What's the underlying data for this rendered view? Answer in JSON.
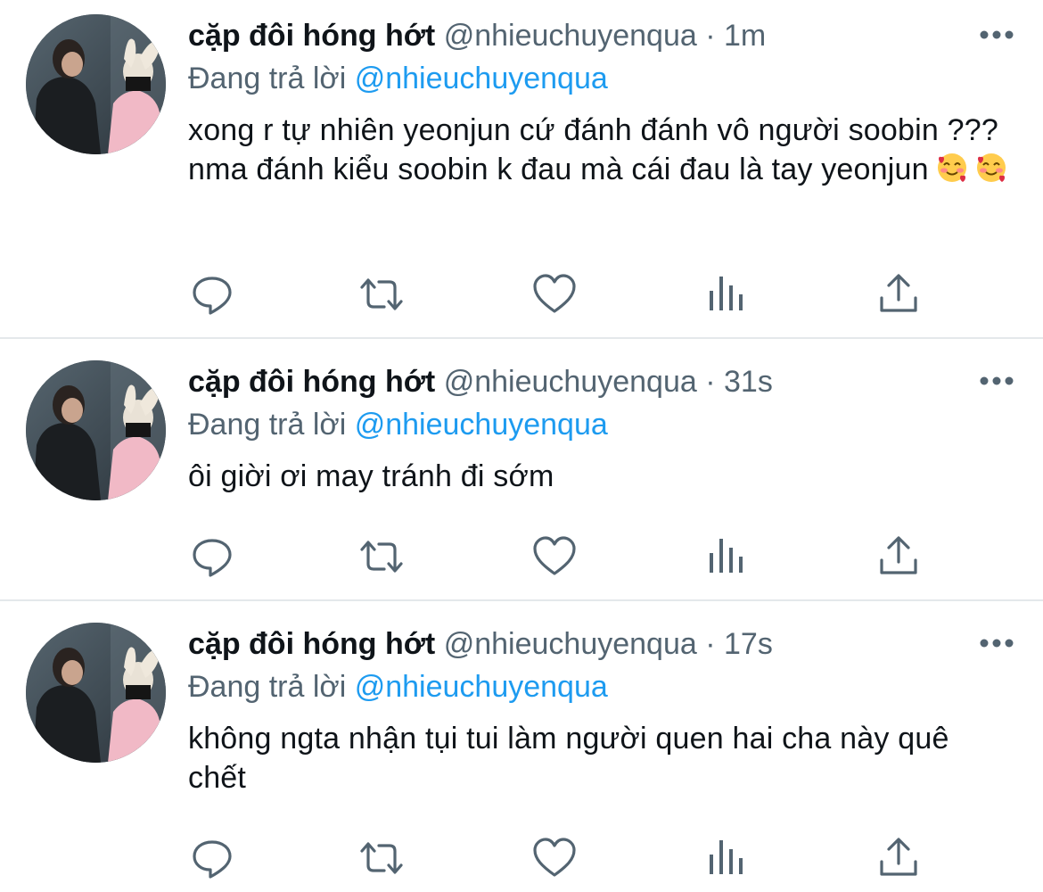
{
  "colors": {
    "text_primary": "#0f1419",
    "text_secondary": "#536471",
    "link": "#1d9bf0",
    "divider": "#e4e8eb"
  },
  "tweets": [
    {
      "display_name": "cặp đôi hóng hớt",
      "handle": "@nhieuchuyenqua",
      "separator": "·",
      "time": "1m",
      "reply_prefix": "Đang trả lời",
      "reply_handle": "@nhieuchuyenqua",
      "text": "xong r tự nhiên yeonjun cứ đánh đánh vô người soobin ??? nma đánh kiểu soobin k đau mà cái đau là tay yeonjun",
      "emojis": [
        "smiling-face-with-hearts",
        "smiling-face-with-hearts"
      ]
    },
    {
      "display_name": "cặp đôi hóng hớt",
      "handle": "@nhieuchuyenqua",
      "separator": "·",
      "time": "31s",
      "reply_prefix": "Đang trả lời",
      "reply_handle": "@nhieuchuyenqua",
      "text": "ôi giời ơi may tránh đi sớm",
      "emojis": []
    },
    {
      "display_name": "cặp đôi hóng hớt",
      "handle": "@nhieuchuyenqua",
      "separator": "·",
      "time": "17s",
      "reply_prefix": "Đang trả lời",
      "reply_handle": "@nhieuchuyenqua",
      "text": "không ngta nhận tụi tui làm người quen hai cha này quê chết",
      "emojis": []
    }
  ],
  "action_icons": [
    "reply-icon",
    "retweet-icon",
    "like-icon",
    "analytics-icon",
    "share-icon"
  ],
  "more_icon": "more-options-icon"
}
